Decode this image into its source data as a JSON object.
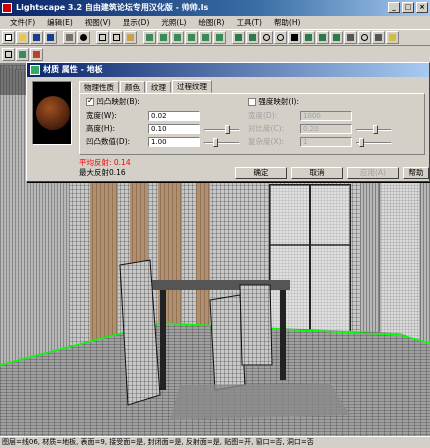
{
  "app": {
    "title": "Lightscape 3.2 自由建筑论坛专用汉化版  - 帅帅.ls",
    "window_buttons": [
      "_",
      "□",
      "×"
    ]
  },
  "menu": [
    "文件(F)",
    "编辑(E)",
    "视图(V)",
    "显示(D)",
    "光照(L)",
    "绘图(R)",
    "工具(T)",
    "帮助(H)"
  ],
  "dialog": {
    "title": "材质 属性 - 地板",
    "tabs": [
      "物理性质",
      "颜色",
      "纹理",
      "过程纹理"
    ],
    "active_tab": 3,
    "bump_map": {
      "label": "凹凸映射(B):",
      "checked": true
    },
    "intensity_map": {
      "label": "强度映射(I):",
      "checked": false
    },
    "width": {
      "label": "宽度(W):",
      "value": "0.02"
    },
    "height": {
      "label": "高度(H):",
      "value": "0.10"
    },
    "bump_value": {
      "label": "凹凸数值(D):",
      "value": "1.00"
    },
    "right_width": {
      "label": "宽度(D):",
      "value": "1000"
    },
    "contrast": {
      "label": "对比度(C):",
      "value": "0.20"
    },
    "complexity": {
      "label": "复杂度(X):",
      "value": "1"
    },
    "avg_reflect": "平均反射: 0.14",
    "max_reflect": "最大反射0.16",
    "buttons": {
      "ok": "确定",
      "cancel": "取消",
      "apply": "应用(A)",
      "help": "帮助"
    }
  },
  "status": "图层=线06, 材质=地板, 表面=9, 接受面=是, 封闭面=是, 反射面=是, 贴图=开, 窗口=否, 洞口=否",
  "colors": {
    "title_start": "#0a246a",
    "title_end": "#a6caf0",
    "floor_line": "#00ff00",
    "reflect_red": "#ff0000"
  }
}
